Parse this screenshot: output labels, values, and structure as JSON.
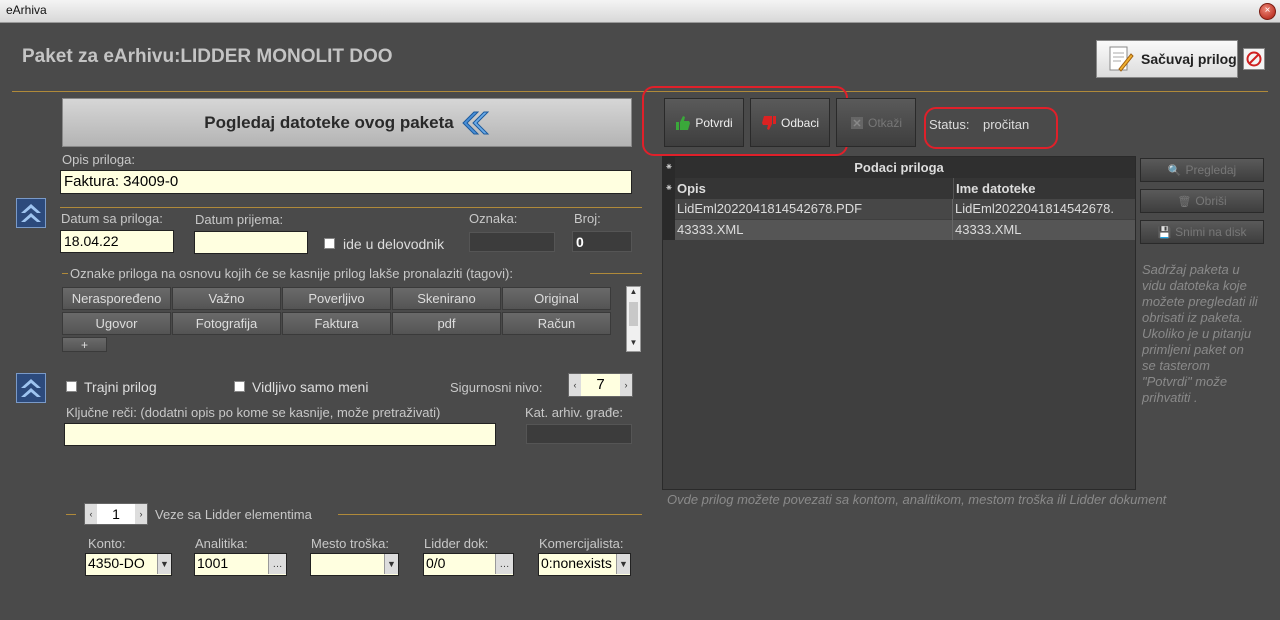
{
  "window": {
    "title": "eArhiva",
    "close_glyph": "×"
  },
  "header": {
    "title": "Paket za eArhivu:LIDDER MONOLIT DOO"
  },
  "toolbar": {
    "save_label": "Sačuvaj prilog",
    "cancel_icon": "no-entry-icon"
  },
  "view_files": {
    "label": "Pogledaj datoteke ovog paketa"
  },
  "actions": {
    "confirm_label": "Potvrdi",
    "reject_label": "Odbaci",
    "cancel_label": "Otkaži"
  },
  "status": {
    "label": "Status:",
    "value": "pročitan"
  },
  "form": {
    "description_label": "Opis priloga:",
    "description_value": "Faktura: 34009-0",
    "date_label": "Datum sa priloga:",
    "date_value": "18.04.22",
    "received_label": "Datum prijema:",
    "received_value": "",
    "ledger_label": "ide u delovodnik",
    "mark_label": "Oznaka:",
    "number_label": "Broj:",
    "number_value": "0"
  },
  "tags": {
    "legend": "Oznake priloga na osnovu kojih će se kasnije prilog lakše pronalaziti (tagovi):",
    "items": [
      "Neraspoređeno",
      "Važno",
      "Poverljivo",
      "Skenirano",
      "Original",
      "Ugovor",
      "Fotografija",
      "Faktura",
      "pdf",
      "Račun"
    ],
    "add_label": "+"
  },
  "options": {
    "permanent_label": "Trajni prilog",
    "only_me_label": "Vidljivo samo meni",
    "security_label": "Sigurnosni nivo:",
    "security_value": "7",
    "keywords_label": "Ključne reči: (dodatni opis po kome se kasnije, može pretraživati)",
    "keywords_value": "",
    "category_label": "Kat. arhiv. građe:"
  },
  "links": {
    "index_value": "1",
    "label": "Veze sa Lidder elementima",
    "konto_label": "Konto:",
    "konto_value": "4350-DO",
    "analytics_label": "Analitika:",
    "analytics_value": "1001",
    "cost_label": "Mesto troška:",
    "cost_value": "",
    "doc_label": "Lidder dok:",
    "doc_value": "0/0",
    "sales_label": "Komercijalista:",
    "sales_value": "0:nonexists"
  },
  "attachments": {
    "title": "Podaci priloga",
    "col_desc": "Opis",
    "col_file": "Ime datoteke",
    "rows": [
      {
        "desc": "LidEml2022041814542678.PDF",
        "file": "LidEml2022041814542678."
      },
      {
        "desc": "43333.XML",
        "file": "43333.XML"
      }
    ]
  },
  "side": {
    "preview_label": "Pregledaj",
    "delete_label": "Obriši",
    "save_disk_label": "Snimi na disk",
    "help": "Sadržaj paketa u vidu datoteka koje možete pregledati ili obrisati iz paketa. Ukoliko je u pitanju primljeni paket on se tasterom \"Potvrdi\" može prihvatiti .",
    "link_hint": "Ovde prilog možete povezati sa kontom, analitikom, mestom troška ili Lidder dokument"
  },
  "colors": {
    "accent_red": "#e0202a",
    "input_bg": "#ffffe0",
    "panel_bg": "#4a4a4a"
  }
}
